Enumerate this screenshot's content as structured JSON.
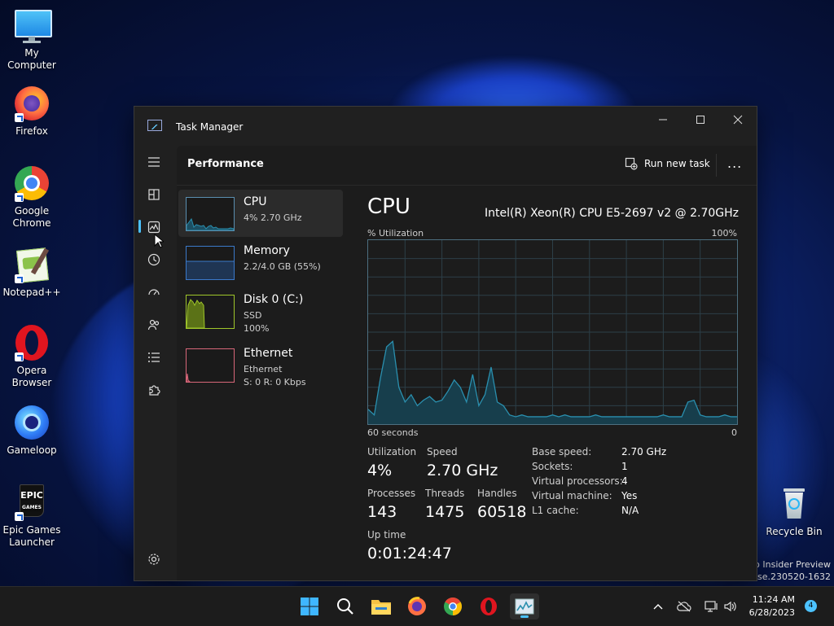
{
  "colors": {
    "accent": "#4cc2ff",
    "cpu_graph": "#2a8fae",
    "memory_graph": "#3b79c9",
    "disk_graph": "#9fc62a",
    "ethernet_graph": "#d8677a"
  },
  "desktop": {
    "icons": [
      {
        "name": "My Computer",
        "icon": "monitor-icon"
      },
      {
        "name": "Firefox",
        "icon": "firefox-icon"
      },
      {
        "name": "Google Chrome",
        "icon": "chrome-icon"
      },
      {
        "name": "Notepad++",
        "icon": "notepadpp-icon"
      },
      {
        "name": "Opera Browser",
        "icon": "opera-icon"
      },
      {
        "name": "Gameloop",
        "icon": "gameloop-icon"
      },
      {
        "name": "Epic Games Launcher",
        "icon": "epic-games-icon"
      }
    ],
    "recycle_bin": "Recycle Bin",
    "watermark_line1": "ro Insider Preview",
    "watermark_line2": "ease.230520-1632"
  },
  "window": {
    "title": "Task Manager",
    "page_title": "Performance",
    "run_new_task": "Run new task",
    "more": "..."
  },
  "perf_list": [
    {
      "name": "CPU",
      "sub1": "4% 2.70 GHz",
      "sub2": ""
    },
    {
      "name": "Memory",
      "sub1": "2.2/4.0 GB (55%)",
      "sub2": ""
    },
    {
      "name": "Disk 0 (C:)",
      "sub1": "SSD",
      "sub2": "100%"
    },
    {
      "name": "Ethernet",
      "sub1": "Ethernet",
      "sub2": "S: 0 R: 0 Kbps"
    }
  ],
  "cpu": {
    "heading": "CPU",
    "model": "Intel(R) Xeon(R) CPU E5-2697 v2 @ 2.70GHz",
    "axis_top_left": "% Utilization",
    "axis_top_right": "100%",
    "axis_bottom_left": "60 seconds",
    "axis_bottom_right": "0",
    "utilization_label": "Utilization",
    "utilization": "4%",
    "speed_label": "Speed",
    "speed": "2.70 GHz",
    "processes_label": "Processes",
    "processes": "143",
    "threads_label": "Threads",
    "threads": "1475",
    "handles_label": "Handles",
    "handles": "60518",
    "uptime_label": "Up time",
    "uptime": "0:01:24:47",
    "specs": [
      {
        "k": "Base speed:",
        "v": "2.70 GHz"
      },
      {
        "k": "Sockets:",
        "v": "1"
      },
      {
        "k": "Virtual processors:",
        "v": "4"
      },
      {
        "k": "Virtual machine:",
        "v": "Yes"
      },
      {
        "k": "L1 cache:",
        "v": "N/A"
      }
    ]
  },
  "chart_data": {
    "type": "area",
    "x": [
      60,
      59,
      58,
      57,
      56,
      55,
      54,
      53,
      52,
      51,
      50,
      49,
      48,
      47,
      46,
      45,
      44,
      43,
      42,
      41,
      40,
      39,
      38,
      37,
      36,
      35,
      34,
      33,
      32,
      31,
      30,
      29,
      28,
      27,
      26,
      25,
      24,
      23,
      22,
      21,
      20,
      19,
      18,
      17,
      16,
      15,
      14,
      13,
      12,
      11,
      10,
      9,
      8,
      7,
      6,
      5,
      4,
      3,
      2,
      1,
      0
    ],
    "series": [
      {
        "values": [
          8,
          5,
          25,
          42,
          45,
          20,
          12,
          16,
          10,
          13,
          15,
          12,
          13,
          18,
          24,
          20,
          12,
          27,
          10,
          16,
          31,
          12,
          10,
          5,
          4,
          5,
          4,
          4,
          4,
          4,
          5,
          4,
          5,
          4,
          4,
          4,
          4,
          5,
          4,
          4,
          4,
          4,
          4,
          4,
          4,
          4,
          4,
          4,
          5,
          4,
          4,
          4,
          12,
          13,
          5,
          4,
          4,
          4,
          5,
          4,
          4
        ]
      }
    ],
    "ylim": [
      0,
      100
    ],
    "xlabel": "60 seconds",
    "ylabel": "% Utilization",
    "grid": true
  },
  "taskbar": {
    "time": "11:24 AM",
    "date": "6/28/2023",
    "notifications": "4"
  }
}
